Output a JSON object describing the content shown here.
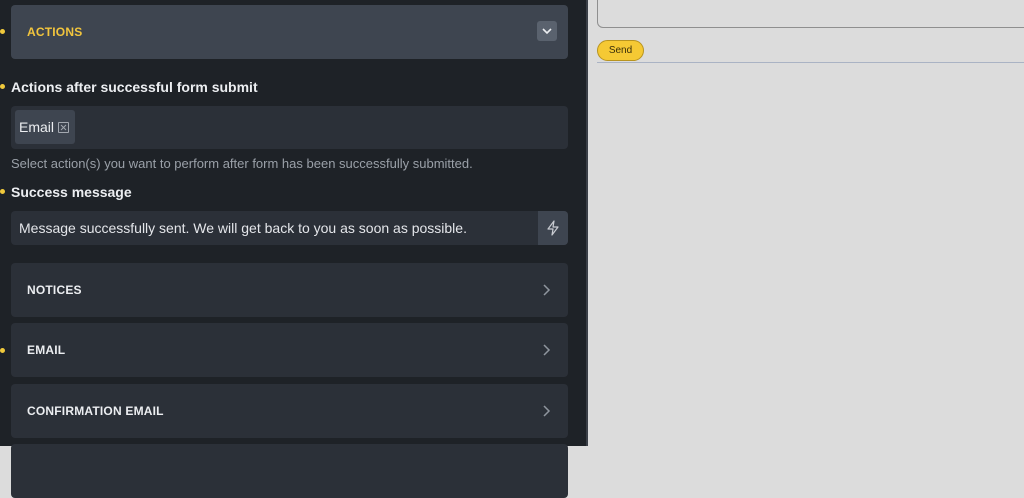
{
  "sections": {
    "actions": "ACTIONS",
    "notices": "NOTICES",
    "email": "EMAIL",
    "confirmation_email": "CONFIRMATION EMAIL"
  },
  "actions_after_submit": {
    "label": "Actions after successful form submit",
    "selected_tag": "Email",
    "help_text": "Select action(s) you want to perform after form has been successfully submitted."
  },
  "success_message": {
    "label": "Success message",
    "value": "Message successfully sent. We will get back to you as soon as possible."
  },
  "preview": {
    "send_label": "Send"
  },
  "colors": {
    "accent": "#f2c53d",
    "panel_bg": "#1e2227",
    "section_bg": "#2b3038",
    "preview_bg": "#dcdcdc"
  },
  "icons": {
    "collapse": "chevron-down-icon",
    "expand": "chevron-right-icon",
    "remove_tag": "close-icon",
    "dynamic_data": "bolt-icon"
  }
}
